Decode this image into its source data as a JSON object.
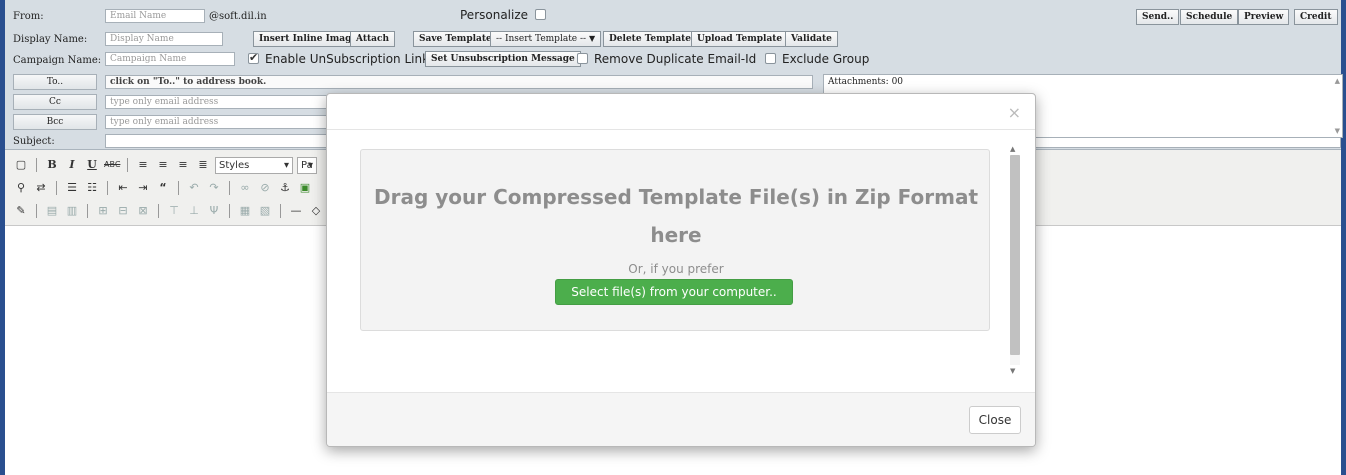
{
  "form": {
    "from_label": "From:",
    "from_placeholder": "Email Name",
    "from_domain": "@soft.dil.in",
    "personalize_label": "Personalize",
    "display_label": "Display Name:",
    "display_placeholder": "Display Name",
    "campaign_label": "Campaign Name:",
    "campaign_placeholder": "Campaign Name",
    "to_button": "To..",
    "to_hint": "click on \"To..\" to address book.",
    "cc_button": "Cc",
    "cc_placeholder": "type only email address",
    "bcc_button": "Bcc",
    "bcc_placeholder": "type only email address",
    "subject_label": "Subject:",
    "attachments_text": "Attachments: 00"
  },
  "top_buttons": {
    "send": "Send..",
    "schedule": "Schedule",
    "preview": "Preview",
    "credit": "Credit"
  },
  "row_buttons": {
    "insert_inline_image": "Insert Inline Image",
    "attach": "Attach",
    "save_template": "Save Template",
    "insert_template": "-- Insert Template --",
    "delete_template": "Delete Template",
    "upload_template": "Upload Template",
    "validate": "Validate",
    "set_unsub": "Set Unsubscription Message"
  },
  "checkboxes": {
    "enable_unsub": "Enable UnSubscription Link",
    "enable_unsub_checked": true,
    "remove_dup": "Remove Duplicate Email-Id",
    "remove_dup_checked": false,
    "exclude_group": "Exclude Group",
    "exclude_group_checked": false
  },
  "editor": {
    "styles_label": "Styles",
    "paragraph_partial": "Pa"
  },
  "modal": {
    "close_x": "×",
    "dropzone_title": "Drag your Compressed Template File(s) in Zip Format here",
    "dropzone_or": "Or, if you prefer",
    "select_button": "Select file(s) from your computer..",
    "close_button": "Close",
    "colors": {
      "select_button_bg": "#4cae4c"
    }
  }
}
